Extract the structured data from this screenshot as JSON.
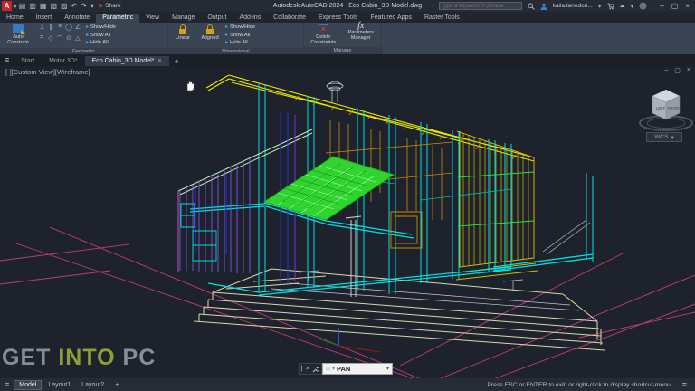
{
  "window": {
    "app_menu": "A",
    "title_app": "Autodesk AutoCAD 2024",
    "title_doc": "Eco Cabin_3D Model.dwg",
    "share_label": "Share",
    "search_placeholder": "Type a keyword or phrase",
    "user_name": "kaila.tanedori..."
  },
  "ribbon": {
    "tabs": [
      "Home",
      "Insert",
      "Annotate",
      "Parametric",
      "View",
      "Manage",
      "Output",
      "Add-ins",
      "Collaborate",
      "Express Tools",
      "Featured Apps",
      "Raster Tools"
    ],
    "active_tab": "Parametric",
    "geometric": {
      "title": "Geometric",
      "auto_constrain": "Auto Constrain",
      "show_hide": "Show/Hide",
      "show_all": "Show All",
      "hide_all": "Hide All"
    },
    "dimensional": {
      "title": "Dimensional",
      "linear": "Linear",
      "aligned": "Aligned",
      "show_hide": "Show/Hide",
      "show_all": "Show All",
      "hide_all": "Hide All"
    },
    "manage": {
      "title": "Manage",
      "delete_constraints_1": "Delete",
      "delete_constraints_2": "Constraints",
      "parameters_manager_1": "Parameters",
      "parameters_manager_2": "Manager"
    }
  },
  "file_tabs": {
    "start": "Start",
    "motor": "Motor 3D*",
    "eco": "Eco Cabin_3D Model*"
  },
  "viewport": {
    "label": "[-][Custom View][Wireframe]",
    "wcs": "WCS"
  },
  "command_line": {
    "value": "PAN"
  },
  "status_bar": {
    "model": "Model",
    "layout1": "Layout1",
    "layout2": "Layout2",
    "plus": "+",
    "hint": "Press ESC or ENTER to exit, or right-click to display shortcut-menu."
  },
  "watermark": {
    "part1": "GET ",
    "part2": "INTO",
    "part3": " PC"
  },
  "glyphs": {
    "caret": "▾",
    "close": "×",
    "minimize": "–",
    "maximize": "▢",
    "hamburger": "≡",
    "plus": "+",
    "undo": "↶",
    "redo": "↷",
    "flag": "⚑",
    "grip": "|",
    "target": "⊙",
    "fx": "fx",
    "red_x": "×",
    "doc1": "▤",
    "doc2": "▥",
    "doc3": "▦",
    "doc4": "▧",
    "doc5": "▨",
    "c1": "⊥",
    "c2": "∥",
    "c3": "≡",
    "c4": "◯",
    "c5": "∠",
    "c6": "=",
    "c7": "◇",
    "c8": "⌒",
    "c9": "⊙",
    "c10": "△",
    "mini": "▸"
  },
  "colors": {
    "canvas_bg": "#1d222d",
    "ribbon_bg": "#3b4452",
    "titlebar_bg": "#262a33",
    "wire_cyan": "#00dede",
    "wire_yellow": "#e8e800",
    "wire_orange": "#cc8a00",
    "wire_green": "#2fd42f",
    "wire_magenta": "#cf3f7f",
    "wire_purple": "#8a5cf6",
    "deck_pale": "#d9d9a6",
    "watermark_gray": "#878d95",
    "watermark_olive": "#8f9f33"
  }
}
